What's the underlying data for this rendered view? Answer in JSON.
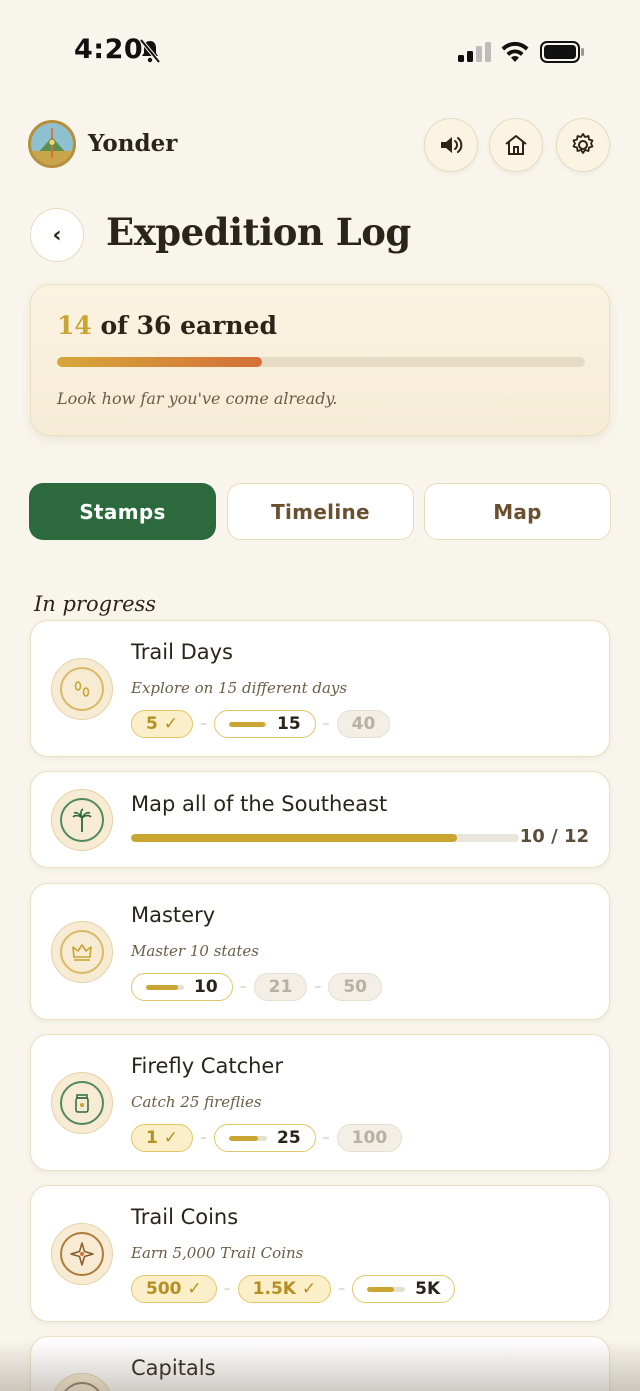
{
  "status_bar": {
    "time": "4:20"
  },
  "header": {
    "app_name": "Yonder"
  },
  "page": {
    "title": "Expedition Log",
    "back_label": "‹"
  },
  "summary": {
    "earned": "14",
    "of_total": " of 36 earned",
    "progress_percent": 38.9,
    "note": "Look how far you've come already."
  },
  "tabs": [
    {
      "label": "Stamps",
      "active": true
    },
    {
      "label": "Timeline",
      "active": false
    },
    {
      "label": "Map",
      "active": false
    }
  ],
  "section": {
    "label": "In progress"
  },
  "stamps": [
    {
      "title": "Trail Days",
      "subtitle": "Explore on 15 different days",
      "icon": "footprints-icon",
      "tiers": [
        {
          "label": "5 ✓",
          "state": "done"
        },
        {
          "label": "15",
          "state": "current",
          "progress": 0.95
        },
        {
          "label": "40",
          "state": "locked"
        }
      ]
    },
    {
      "title": "Map all of the Southeast",
      "icon": "palm-tree-icon",
      "progress": 0.833,
      "count": "10 / 12"
    },
    {
      "title": "Mastery",
      "subtitle": "Master 10 states",
      "icon": "crown-icon",
      "tiers": [
        {
          "label": "10",
          "state": "current",
          "progress": 0.85
        },
        {
          "label": "21",
          "state": "locked"
        },
        {
          "label": "50",
          "state": "locked"
        }
      ]
    },
    {
      "title": "Firefly Catcher",
      "subtitle": "Catch 25 fireflies",
      "icon": "jar-icon",
      "tiers": [
        {
          "label": "1 ✓",
          "state": "done"
        },
        {
          "label": "25",
          "state": "current",
          "progress": 0.75
        },
        {
          "label": "100",
          "state": "locked"
        }
      ]
    },
    {
      "title": "Trail Coins",
      "subtitle": "Earn 5,000 Trail Coins",
      "icon": "compass-star-icon",
      "tiers": [
        {
          "label": "500 ✓",
          "state": "done"
        },
        {
          "label": "1.5K ✓",
          "state": "done"
        },
        {
          "label": "5K",
          "state": "current",
          "progress": 0.7
        }
      ]
    },
    {
      "title": "Capitals",
      "icon": "capitol-icon"
    }
  ],
  "colors": {
    "background": "#f8f5ec",
    "accent_green": "#2c6a3e",
    "gold": "#c9a532",
    "progress_orange": "#d4703a"
  }
}
